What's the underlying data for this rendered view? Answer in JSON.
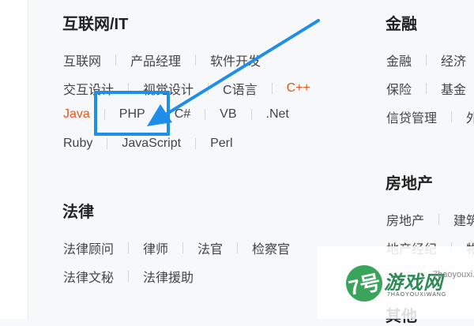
{
  "left": {
    "internet": {
      "title": "互联网/IT",
      "rows": [
        [
          "互联网",
          "产品经理",
          "软件开发"
        ],
        [
          "交互设计",
          "视觉设计",
          "C语言",
          "C++"
        ],
        [
          "Java",
          "PHP",
          "C#",
          "VB",
          ".Net"
        ],
        [
          "Ruby",
          "JavaScript",
          "Perl"
        ]
      ]
    },
    "law": {
      "title": "法律",
      "rows": [
        [
          "法律顾问",
          "律师",
          "法官",
          "检察官"
        ],
        [
          "法律文秘",
          "法律援助"
        ]
      ]
    }
  },
  "right": {
    "finance": {
      "title": "金融",
      "rows": [
        [
          "金融",
          "经济"
        ],
        [
          "保险",
          "基金"
        ],
        [
          "信贷管理",
          "外"
        ]
      ]
    },
    "realestate": {
      "title": "房地产",
      "rows": [
        [
          "房地产",
          "建筑"
        ],
        [
          "地产经纪",
          "物"
        ]
      ]
    },
    "other": {
      "title": "其他"
    }
  },
  "hot_color": "#e8551c",
  "annotation_color": "#1f8ee8",
  "watermark": {
    "badge": "7号",
    "brand": "游戏网",
    "sub": "7HAOYOUXIWANG",
    "url": "7haoyouxi.com"
  }
}
